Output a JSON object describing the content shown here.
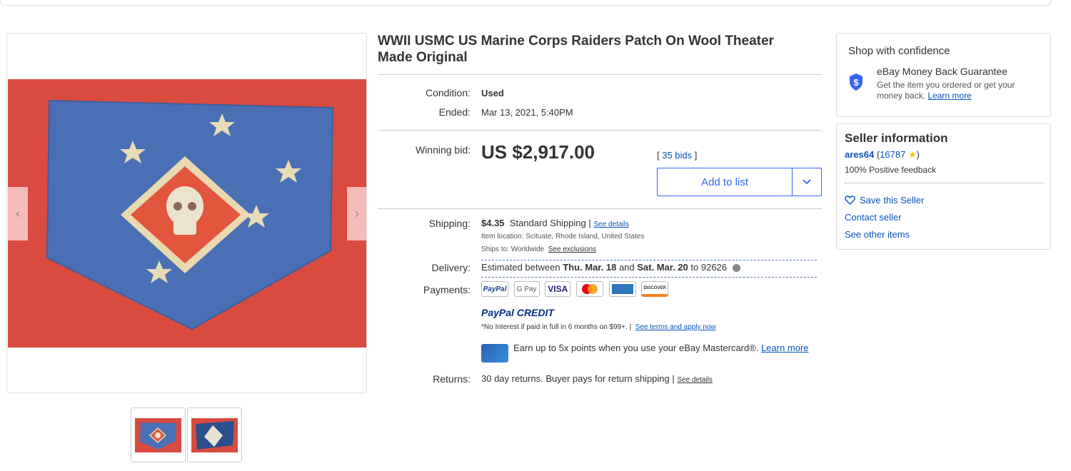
{
  "listing": {
    "title": "WWII USMC US Marine Corps Raiders Patch On Wool Theater Made Original"
  },
  "gallery": {
    "prev_icon": "chevron-left-icon",
    "next_icon": "chevron-right-icon",
    "prev_glyph": "‹",
    "next_glyph": "›"
  },
  "item_details": {
    "condition_label": "Condition:",
    "condition_value": "Used",
    "ended_label": "Ended:",
    "ended_value": "Mar 13, 2021, 5:40PM"
  },
  "bidding": {
    "winning_label": "Winning bid:",
    "winning_value": "US $2,917.00",
    "bids_open": "[ ",
    "bids_link": "35 bids",
    "bids_close": " ]",
    "add_to_list": "Add to list"
  },
  "shipping": {
    "label": "Shipping:",
    "cost": "$4.35",
    "method": "Standard Shipping |",
    "details_link": "See details",
    "item_location": "Item location:  Scituate, Rhode Island, United States",
    "ships_to": "Ships to:  Worldwide",
    "exclusions_link": "See exclusions"
  },
  "delivery": {
    "label": "Delivery:",
    "text_pre": "Estimated between ",
    "date1": "Thu. Mar. 18",
    "text_mid": " and ",
    "date2": "Sat. Mar. 20",
    "text_post": " to 92626"
  },
  "payments": {
    "label": "Payments:",
    "methods": [
      "PayPal",
      "G Pay",
      "VISA",
      "Mastercard",
      "AMEX",
      "DISCOVER"
    ],
    "paypal_credit_a": "PayPal",
    "paypal_credit_b": "CREDIT",
    "credit_note": "*No Interest if paid in full in 6 months on $99+.  |",
    "credit_link": "See terms and apply now",
    "mastercard_promo": "Earn up to 5x points when you use your eBay Mastercard®.",
    "learn_more": "Learn more"
  },
  "returns": {
    "label": "Returns:",
    "text": "30 day returns. Buyer pays for return shipping |",
    "details_link": "See details"
  },
  "confidence": {
    "title": "Shop with confidence",
    "guarantee_title": "eBay Money Back Guarantee",
    "guarantee_text": "Get the item you ordered or get your money back.",
    "learn_more": "Learn more"
  },
  "seller": {
    "title": "Seller information",
    "name": "ares64",
    "feedback_open": " (",
    "feedback_score": "16787",
    "feedback_close": ")",
    "positive": "100% Positive feedback",
    "save": "Save this Seller",
    "contact": "Contact seller",
    "other_items": "See other items"
  },
  "colors": {
    "link": "#0654ba",
    "primary": "#3665f3",
    "patch_blue": "#4a6fb5",
    "background_red": "#d94a3f"
  }
}
